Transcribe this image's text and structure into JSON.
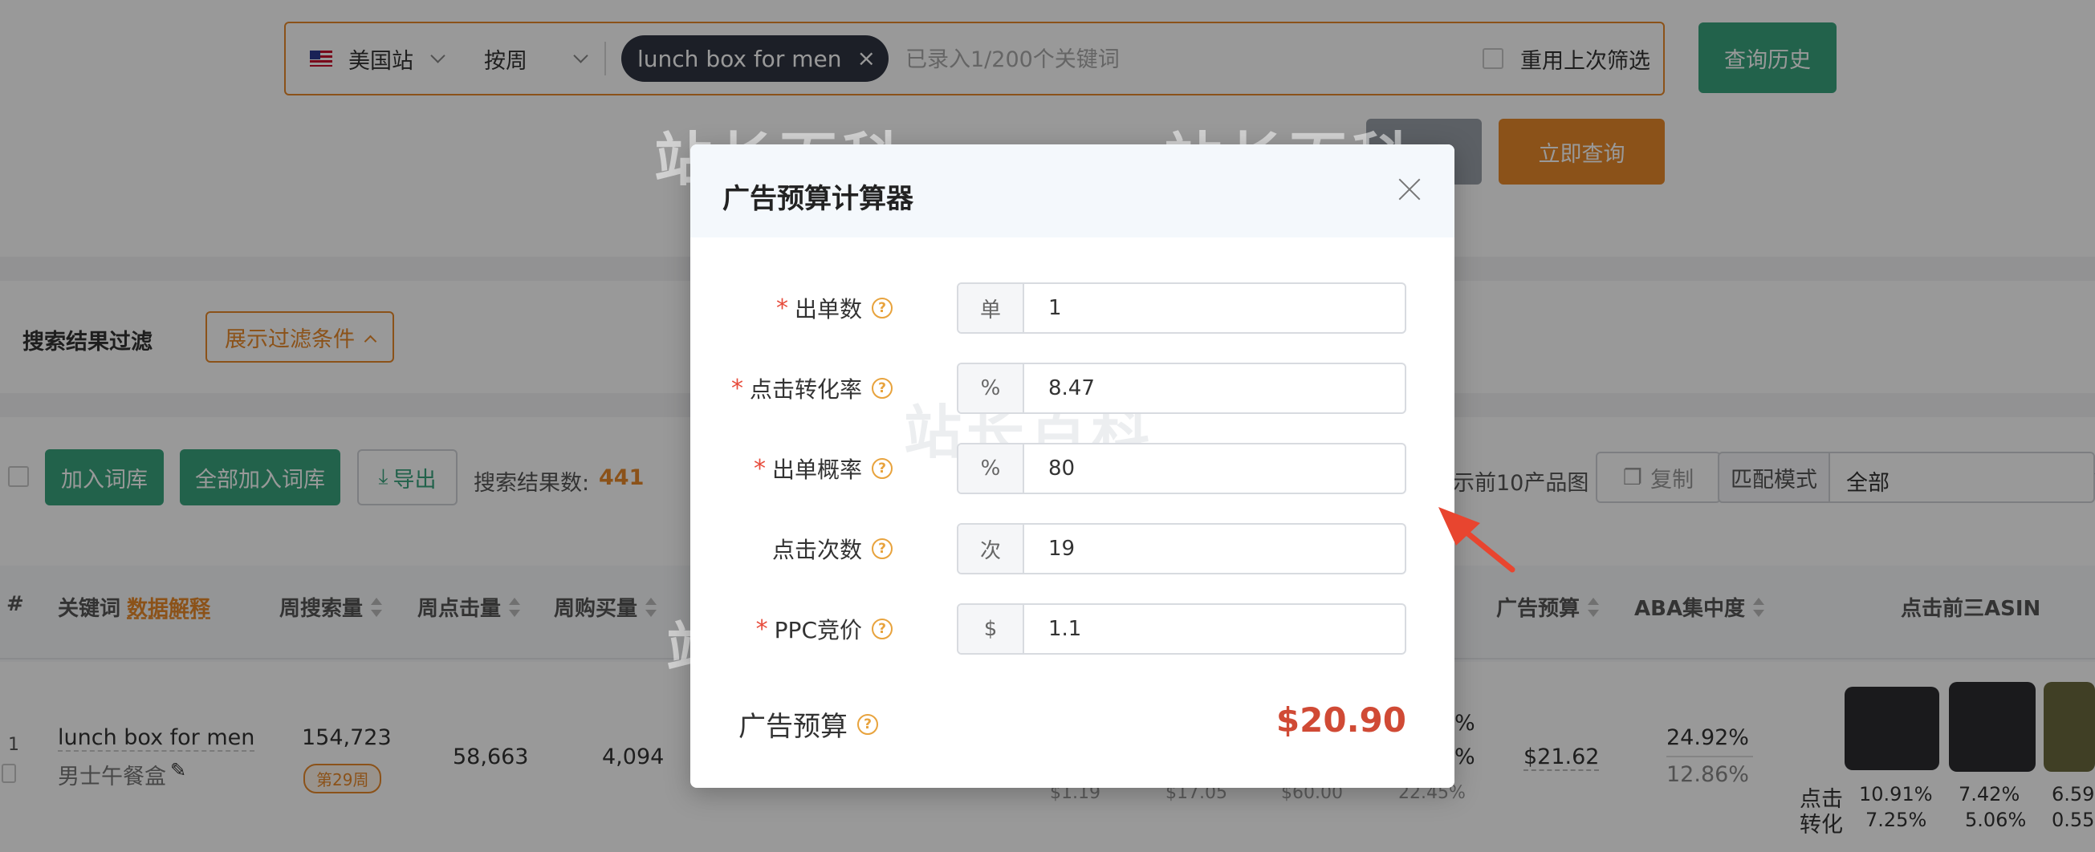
{
  "search": {
    "site": "美国站",
    "period": "按周",
    "keyword_chip": "lunch box for men",
    "hint": "已录入1/200个关键词",
    "reuse_label": "重用上次筛选",
    "history_button": "查询历史",
    "query_button": "立即查询"
  },
  "filter": {
    "label": "搜索结果过滤",
    "toggle_button": "展示过滤条件"
  },
  "toolbar": {
    "add_button": "加入词库",
    "add_all_button": "全部加入词库",
    "export_button": "导出",
    "result_count_label": "搜索结果数:",
    "result_count": "441",
    "top10_label": "示前10产品图",
    "copy_button": "复制",
    "match_mode_label": "匹配模式",
    "match_mode_value": "全部"
  },
  "table": {
    "headers": {
      "index": "#",
      "keyword": "关键词",
      "keyword_help": "数据解释",
      "weekly_search": "周搜索量",
      "weekly_clicks": "周点击量",
      "weekly_purchases": "周购买量",
      "ad_budget": "广告预算",
      "aba_concentration": "ABA集中度",
      "top3_asin": "点击前三ASIN"
    },
    "row": {
      "index": "1",
      "keyword": "lunch box for men",
      "keyword_cn": "男士午餐盒",
      "week_badge": "第29周",
      "weekly_search": "154,723",
      "weekly_clicks": "58,663",
      "weekly_purchases": "4,094",
      "hidden_pct1": "%",
      "hidden_pct2": "%",
      "ad_budget": "$21.62",
      "aba_1": "24.92%",
      "aba_2": "12.86%",
      "sub_values": [
        "$1.19",
        "$17.05",
        "$60.00",
        "22.45%"
      ],
      "click_label": "点击",
      "conv_label": "转化",
      "asin_click": [
        "10.91%",
        "7.42%",
        "6.59"
      ],
      "asin_conv": [
        "7.25%",
        "5.06%",
        "0.55"
      ]
    }
  },
  "watermark": "站长百科",
  "modal": {
    "title": "广告预算计算器",
    "fields": [
      {
        "label": "出单数",
        "required": true,
        "addon": "单",
        "value": "1"
      },
      {
        "label": "点击转化率",
        "required": true,
        "addon": "%",
        "value": "8.47"
      },
      {
        "label": "出单概率",
        "required": true,
        "addon": "%",
        "value": "80"
      },
      {
        "label": "点击次数",
        "required": false,
        "addon": "次",
        "value": "19"
      },
      {
        "label": "PPC竞价",
        "required": true,
        "addon": "$",
        "value": "1.1"
      }
    ],
    "budget_label": "广告预算",
    "budget_value": "$20.90"
  },
  "colors": {
    "accent_orange": "#e8892a",
    "accent_green": "#3aa47e",
    "budget_red": "#d04a35",
    "annotation_arrow": "#e8452f"
  }
}
